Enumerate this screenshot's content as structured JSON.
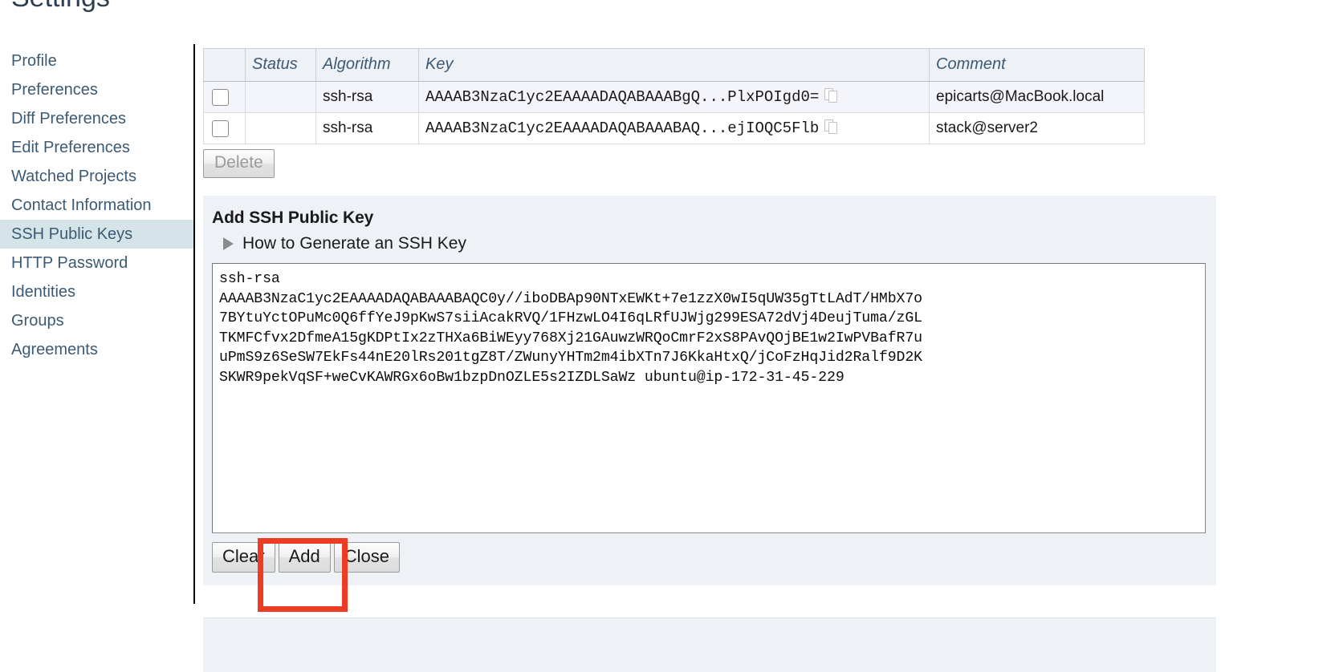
{
  "page": {
    "title": "Settings"
  },
  "sidebar": {
    "items": [
      {
        "label": "Profile",
        "active": false
      },
      {
        "label": "Preferences",
        "active": false
      },
      {
        "label": "Diff Preferences",
        "active": false
      },
      {
        "label": "Edit Preferences",
        "active": false
      },
      {
        "label": "Watched Projects",
        "active": false
      },
      {
        "label": "Contact Information",
        "active": false
      },
      {
        "label": "SSH Public Keys",
        "active": true
      },
      {
        "label": "HTTP Password",
        "active": false
      },
      {
        "label": "Identities",
        "active": false
      },
      {
        "label": "Groups",
        "active": false
      },
      {
        "label": "Agreements",
        "active": false
      }
    ]
  },
  "keys_table": {
    "columns": [
      "",
      "Status",
      "Algorithm",
      "Key",
      "Comment"
    ],
    "rows": [
      {
        "checked": false,
        "status": "",
        "algorithm": "ssh-rsa",
        "key": "AAAAB3NzaC1yc2EAAAADAQABAAABgQ...PlxPOIgd0=",
        "copy_icon": "copy-icon",
        "comment": "epicarts@MacBook.local"
      },
      {
        "checked": false,
        "status": "",
        "algorithm": "ssh-rsa",
        "key": "AAAAB3NzaC1yc2EAAAADAQABAAABAQ...ejIOQC5Flb",
        "copy_icon": "copy-icon",
        "comment": "stack@server2"
      }
    ],
    "delete_label": "Delete",
    "delete_disabled": true
  },
  "add_panel": {
    "title": "Add SSH Public Key",
    "disclosure_icon": "triangle-right-icon",
    "disclosure_label": "How to Generate an SSH Key",
    "textarea_placeholder": "",
    "textarea_value": "ssh-rsa\nAAAAB3NzaC1yc2EAAAADAQABAAABAQC0y//iboDBAp90NTxEWKt+7e1zzX0wI5qUW35gTtLAdT/HMbX7o\n7BYtuYctOPuMc0Q6ffYeJ9pKwS7siiAcakRVQ/1FHzwLO4I6qLRfUJWjg299ESA72dVj4DeujTuma/zGL\nTKMFCfvx2DfmeA15gKDPtIx2zTHXa6BiWEyy768Xj21GAuwzWRQoCmrF2xS8PAvQOjBE1w2IwPVBafR7u\nuPmS9z6SeSW7EkFs44nE20lRs201tgZ8T/ZWunyYHTm2m4ibXTn7J6KkaHtxQ/jCoFzHqJid2Ralf9D2K\nSKWR9pekVqSF+weCvKAWRGx6oBw1bzpDnOZLE5s2IZDLSaWz ubuntu@ip-172-31-45-229",
    "buttons": [
      {
        "label": "Clear",
        "name": "clear-button"
      },
      {
        "label": "Add",
        "name": "add-button"
      },
      {
        "label": "Close",
        "name": "close-button"
      }
    ]
  },
  "annotation": {
    "color": "#ec3c24",
    "target": "add-button"
  }
}
